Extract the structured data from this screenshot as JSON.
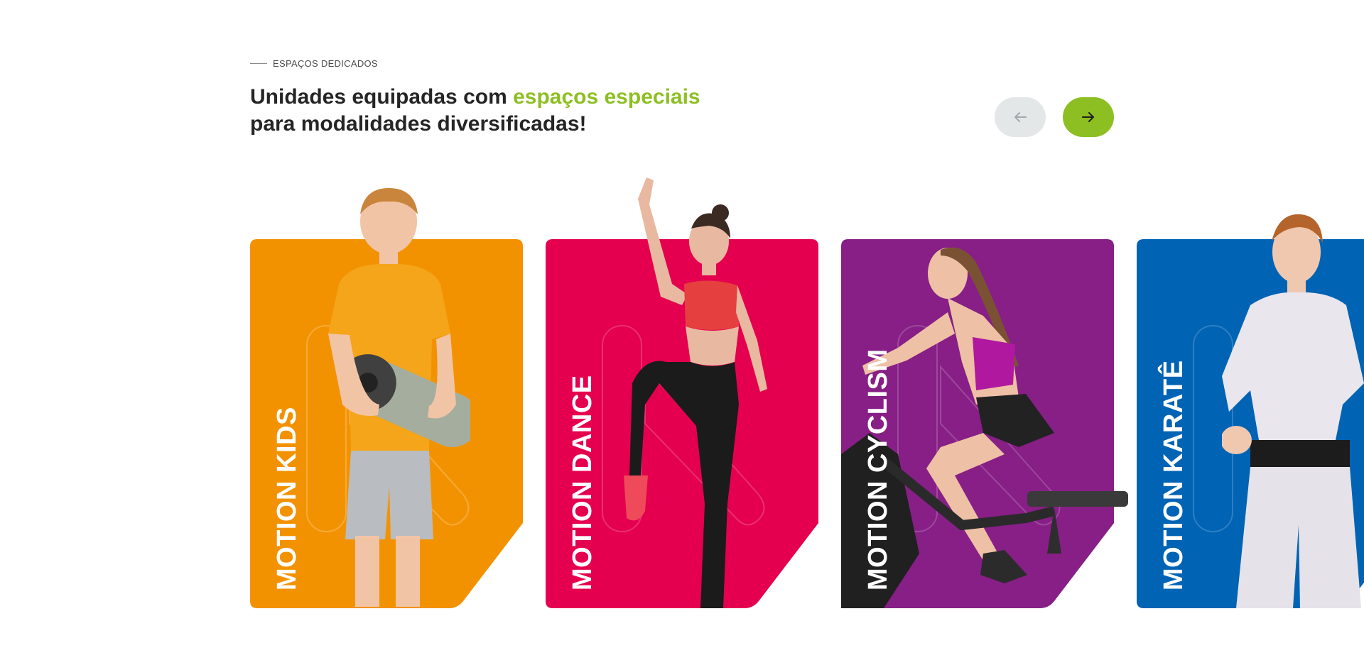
{
  "header": {
    "eyebrow": "ESPAÇOS DEDICADOS",
    "title_part1": "Unidades equipadas com ",
    "title_accent1": "espaços especiais",
    "title_part2": " para modalidades diversificadas!"
  },
  "nav": {
    "prev_icon": "arrow-left-icon",
    "next_icon": "arrow-right-icon"
  },
  "cards": [
    {
      "label": "MOTION  KIDS",
      "color": "#f39200"
    },
    {
      "label": "MOTION  DANCE",
      "color": "#e5004f"
    },
    {
      "label": "MOTION  CYCLISM",
      "color": "#871f86"
    },
    {
      "label": "MOTION  KARATÊ",
      "color": "#0063b4"
    }
  ],
  "colors": {
    "accent": "#8dbf22",
    "text": "#252525"
  }
}
